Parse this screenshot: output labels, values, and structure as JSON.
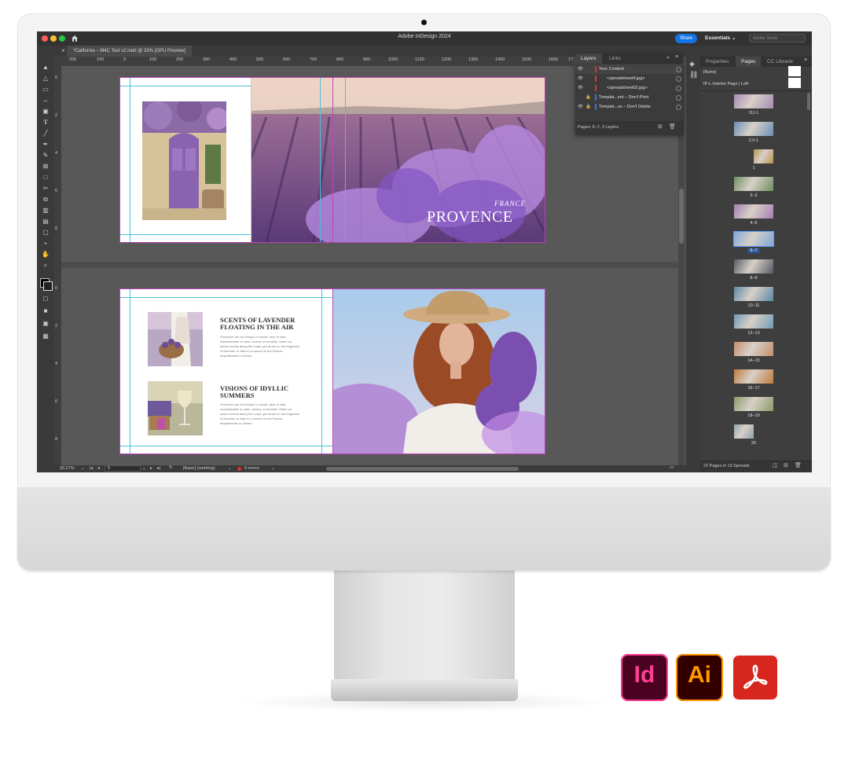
{
  "app": {
    "window_title": "Adobe InDesign 2024",
    "share_label": "Share",
    "workspace_label": "Essentials ⌄",
    "stock_search_placeholder": "Adobe Stock",
    "document_tab": "*California – M4C Test v2.indd @ 33% [GPU Preview]",
    "close_glyph": "×"
  },
  "ruler": {
    "h_ticks": [
      "200",
      "100",
      "0",
      "100",
      "200",
      "300",
      "400",
      "500",
      "600",
      "700",
      "800",
      "900",
      "1000",
      "1100",
      "1200",
      "1300",
      "1400",
      "1500",
      "1600",
      "17"
    ],
    "v_ticks": [
      "0",
      "2",
      "4",
      "6",
      "8",
      "0",
      "2",
      "4",
      "6",
      "8"
    ]
  },
  "spread1": {
    "pre_title": "FRANCE",
    "title": "PROVENCE"
  },
  "spread2": {
    "article1": {
      "heading": "SCENTS OF LAVENDER FLOATING IN THE AIR",
      "body": "Provence can be tranquil or social, wise or wild, unpredictable or calm, stormy or sensible. Seek out secret creeks along the coast, get drunk on the fragrance of lavender or take in a concert in the Roman amphitheatre in Nîmes."
    },
    "article2": {
      "heading": "VISIONS OF IDYLLIC SUMMERS",
      "body": "Provence can be tranquil or social, wise or wild, unpredictable or calm, stormy or sensible. Seek out secret creeks along the coast, get drunk on the fragrance of lavender or take in a concert in the Roman amphitheatre in Nîmes."
    }
  },
  "status": {
    "zoom": "33.27%",
    "page": "5",
    "preflight_profile": "[Basic] (working)",
    "errors": "9 errors"
  },
  "layers_panel": {
    "tabs": [
      "Layers",
      "Links"
    ],
    "rows": [
      {
        "label": "Your Content",
        "color": "#e0303a"
      },
      {
        "label": "<spreadsheet4.jpg>",
        "color": "#e0303a"
      },
      {
        "label": "<spreadsheet02.jpg>",
        "color": "#e0303a"
      },
      {
        "label": "Templat...ent – Don't Print",
        "color": "#3a74e0"
      },
      {
        "label": "Templat...es – Don't Delete",
        "color": "#3a74e0"
      }
    ],
    "footer": "Pages: 6–7, 3 Layers"
  },
  "pages_panel": {
    "tabs": [
      "Properties",
      "Pages",
      "CC Librarie"
    ],
    "parents": [
      "[None]",
      "IP-L-Interior Page | Left"
    ],
    "pages": [
      {
        "label": "DJ-1",
        "color": "#a58bb5"
      },
      {
        "label": "CV-1",
        "color": "#6c8fb6"
      },
      {
        "label": "1",
        "color": "#b7944f"
      },
      {
        "label": "2–3",
        "color": "#6f8f63"
      },
      {
        "label": "4–5",
        "color": "#a67fb2"
      },
      {
        "label": "6–7",
        "color": "#7ea7d8",
        "selected": true
      },
      {
        "label": "8–9",
        "color": "#555a66"
      },
      {
        "label": "10–11",
        "color": "#5d89a6"
      },
      {
        "label": "12–13",
        "color": "#6f9bb4"
      },
      {
        "label": "14–15",
        "color": "#c48f6a"
      },
      {
        "label": "16–17",
        "color": "#c07d3e"
      },
      {
        "label": "18–19",
        "color": "#8a9b6a"
      },
      {
        "label": "20",
        "color": "#8fa3ad"
      }
    ],
    "footer": "22 Pages in 13 Spreads"
  },
  "app_icons": [
    {
      "label": "Id",
      "bg": "#49021f",
      "fg": "#ff3f94"
    },
    {
      "label": "Ai",
      "bg": "#330000",
      "fg": "#ff9a00"
    },
    {
      "label": "",
      "bg": "#d7261d",
      "fg": "#ffffff"
    }
  ]
}
